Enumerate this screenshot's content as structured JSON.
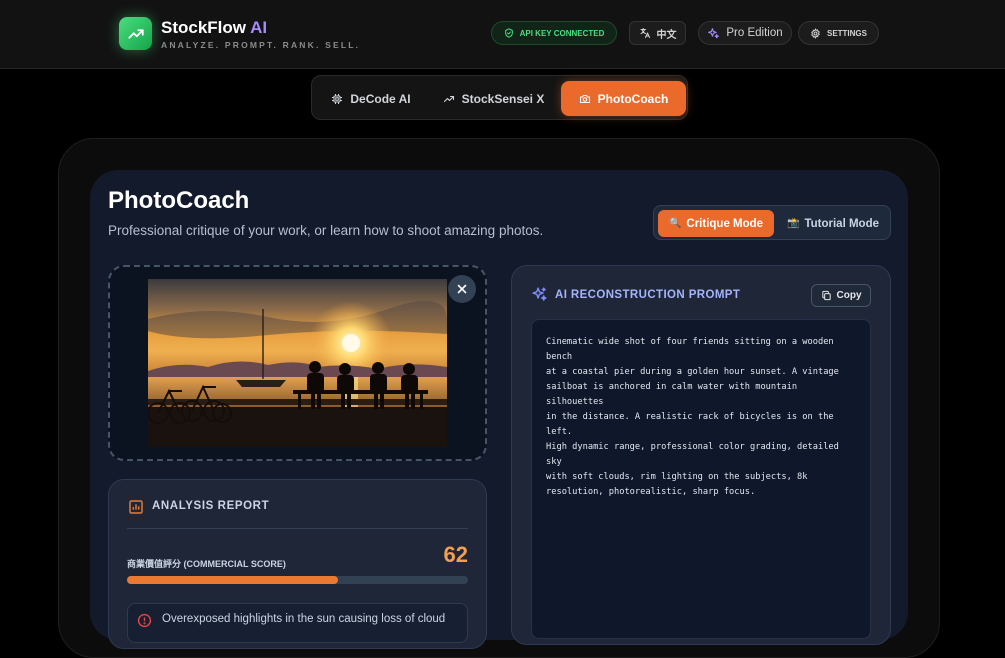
{
  "header": {
    "brand_main": "StockFlow",
    "brand_ai": " AI",
    "tagline": "ANALYZE. PROMPT. RANK. SELL.",
    "api_status": "API KEY CONNECTED",
    "language": "中文",
    "edition": "Pro Edition",
    "settings": "SETTINGS"
  },
  "nav": {
    "tabs": [
      {
        "label": "DeCode AI"
      },
      {
        "label": "StockSensei X"
      },
      {
        "label": "PhotoCoach"
      }
    ],
    "active": "PhotoCoach"
  },
  "page": {
    "title": "PhotoCoach",
    "subtitle": "Professional critique of your work, or learn how to shoot amazing photos.",
    "modes": [
      {
        "label": "Critique Mode",
        "emoji": "🔍"
      },
      {
        "label": "Tutorial Mode",
        "emoji": "📸"
      }
    ]
  },
  "report": {
    "title": "ANALYSIS REPORT",
    "score_label": "商業價值評分 (COMMERCIAL SCORE)",
    "score": "62",
    "score_fraction": 0.62,
    "issue": "Overexposed highlights in the sun causing loss of cloud"
  },
  "prompt": {
    "title": "AI RECONSTRUCTION PROMPT",
    "copy_label": "Copy",
    "text": "Cinematic wide shot of four friends sitting on a wooden bench\nat a coastal pier during a golden hour sunset. A vintage\nsailboat is anchored in calm water with mountain silhouettes\nin the distance. A realistic rack of bicycles is on the left.\nHigh dynamic range, professional color grading, detailed sky\nwith soft clouds, rim lighting on the subjects, 8k\nresolution, photorealistic, sharp focus."
  },
  "colors": {
    "accent": "#ea6a2b",
    "success": "#4ade80",
    "brand_ai": "#a78bfa"
  }
}
